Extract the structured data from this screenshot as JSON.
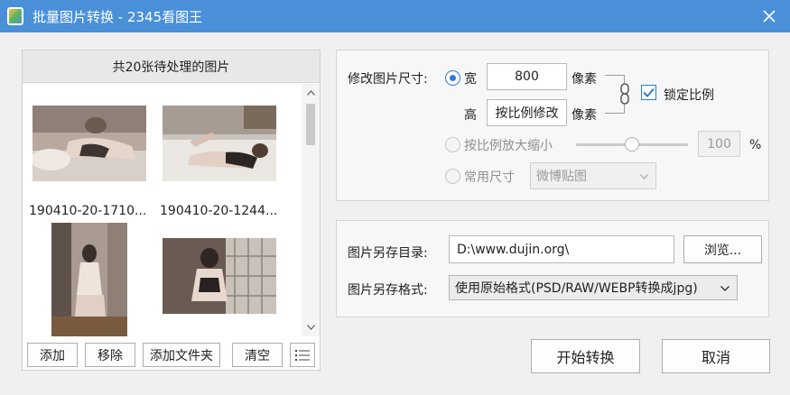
{
  "window": {
    "title": "批量图片转换 - 2345看图王"
  },
  "icons": {
    "app": "app-logo-icon",
    "close": "close-icon",
    "scroll_up": "chevron-up-icon",
    "scroll_down": "chevron-down-icon",
    "list_menu": "list-menu-icon",
    "link": "chain-link-icon",
    "check": "checkmark-icon",
    "dropdown": "chevron-down-icon"
  },
  "colors": {
    "titlebar": "#4a90d9",
    "accent": "#2d7bd6"
  },
  "file_list": {
    "header": "共20张待处理的图片",
    "items": [
      {
        "name": "190410-20-1710...",
        "image": "bedroom-portrait-photo"
      },
      {
        "name": "190410-20-1244...",
        "image": "bedroom-portrait-photo"
      },
      {
        "name": "",
        "image": "sitting-portrait-photo"
      },
      {
        "name": "",
        "image": "window-portrait-photo"
      }
    ],
    "buttons": {
      "add": "添加",
      "remove": "移除",
      "add_folder": "添加文件夹",
      "clear": "清空"
    }
  },
  "resize": {
    "label": "修改图片尺寸:",
    "width_label": "宽",
    "width_value": "800",
    "width_unit": "像素",
    "height_label": "高",
    "height_value": "按比例修改",
    "height_unit": "像素",
    "lock_ratio_label": "锁定比例",
    "lock_ratio_checked": true,
    "scale_label": "按比例放大缩小",
    "scale_value": "100",
    "scale_unit": "%",
    "scale_slider_level": 0.5,
    "common_size_label": "常用尺寸",
    "common_size_value": "微博贴图",
    "selected_mode": "custom"
  },
  "output": {
    "dir_label": "图片另存目录:",
    "dir_value": "D:\\www.dujin.org\\",
    "browse_label": "浏览...",
    "format_label": "图片另存格式:",
    "format_value": "使用原始格式(PSD/RAW/WEBP转换成jpg)"
  },
  "actions": {
    "start": "开始转换",
    "cancel": "取消"
  }
}
